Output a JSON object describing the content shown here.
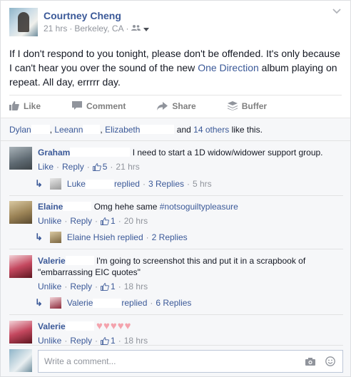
{
  "post": {
    "author": "Courtney Cheng",
    "time": "21 hrs",
    "location": "Berkeley, CA",
    "audience_icon": "friends-icon",
    "body_before": "If I don't respond to you tonight, please don't be offended. It's only because I can't hear you over the sound of the new ",
    "body_link": "One Direction",
    "body_after": " album playing on repeat. All day, errrrr day."
  },
  "actions": {
    "like": "Like",
    "comment": "Comment",
    "share": "Share",
    "buffer": "Buffer"
  },
  "likes": {
    "name1": "Dylan",
    "name2": "Leeann",
    "name3": "Elizabeth",
    "and_text": "and",
    "others": "14 others",
    "suffix": "like this."
  },
  "comments": [
    {
      "name": "Graham",
      "text": "I need to start a 1D widow/widower support group.",
      "like": "Like",
      "reply": "Reply",
      "likes": "5",
      "time": "21 hrs",
      "reply_name": "Luke",
      "reply_text": "replied",
      "replies": "3 Replies",
      "reply_time": "5 hrs",
      "avatar_color": "#7d8a94"
    },
    {
      "name": "Elaine",
      "text_before": "Omg hehe same ",
      "hashtag": "#notsoguiltypleasure",
      "like": "Unlike",
      "reply": "Reply",
      "likes": "1",
      "time": "20 hrs",
      "reply_name": "Elaine Hsieh",
      "reply_text": "replied",
      "replies": "2 Replies",
      "avatar_color": "#b9a17a"
    },
    {
      "name": "Valerie",
      "text": "I'm going to screenshot this and put it in a scrapbook of \"embarrassing EIC quotes\"",
      "like": "Unlike",
      "reply": "Reply",
      "likes": "1",
      "time": "18 hrs",
      "reply_name": "Valerie",
      "reply_text": "replied",
      "replies": "6 Replies",
      "avatar_color": "#8c2a3a"
    },
    {
      "name": "Valerie",
      "hearts": "♥♥♥♥♥",
      "like": "Unlike",
      "reply": "Reply",
      "likes": "1",
      "time": "18 hrs",
      "avatar_color": "#8c2a3a"
    }
  ],
  "composer": {
    "placeholder": "Write a comment...",
    "camera_icon": "camera-icon",
    "emoji_icon": "emoji-icon"
  }
}
